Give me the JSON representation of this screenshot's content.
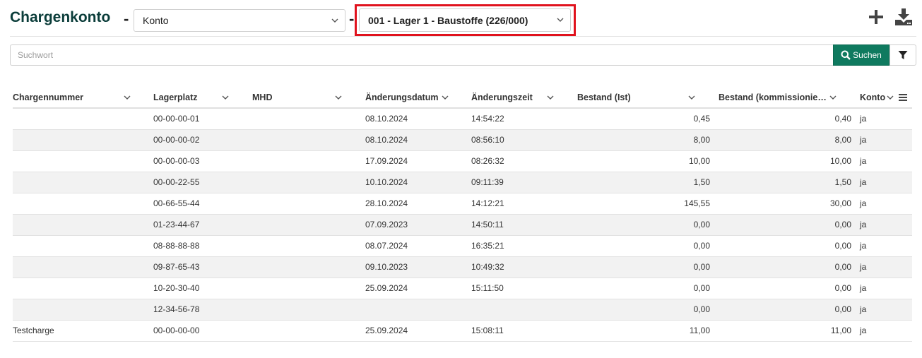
{
  "header": {
    "title": "Chargenkonto",
    "separator": "-",
    "konto_select": "Konto",
    "lager_select": "001 - Lager 1 - Baustoffe (226/000)"
  },
  "search": {
    "placeholder": "Suchwort",
    "button_label": "Suchen"
  },
  "icons": [
    "plus-icon",
    "download-icon",
    "search-icon",
    "filter-icon",
    "chevron-down-icon",
    "menu-icon"
  ],
  "colors": {
    "title": "#0b3d3a",
    "accent": "#0f7a5f",
    "highlight": "#e0121d"
  },
  "table": {
    "columns": [
      "Chargennummer",
      "Lagerplatz",
      "MHD",
      "Änderungsdatum",
      "Änderungszeit",
      "Bestand (Ist)",
      "Bestand (kommissionie…",
      "Konto"
    ],
    "rows": [
      [
        "",
        "00-00-00-01",
        "",
        "08.10.2024",
        "14:54:22",
        "0,45",
        "0,40",
        "ja"
      ],
      [
        "",
        "00-00-00-02",
        "",
        "08.10.2024",
        "08:56:10",
        "8,00",
        "8,00",
        "ja"
      ],
      [
        "",
        "00-00-00-03",
        "",
        "17.09.2024",
        "08:26:32",
        "10,00",
        "10,00",
        "ja"
      ],
      [
        "",
        "00-00-22-55",
        "",
        "10.10.2024",
        "09:11:39",
        "1,50",
        "1,50",
        "ja"
      ],
      [
        "",
        "00-66-55-44",
        "",
        "28.10.2024",
        "14:12:21",
        "145,55",
        "30,00",
        "ja"
      ],
      [
        "",
        "01-23-44-67",
        "",
        "07.09.2023",
        "14:50:11",
        "0,00",
        "0,00",
        "ja"
      ],
      [
        "",
        "08-88-88-88",
        "",
        "08.07.2024",
        "16:35:21",
        "0,00",
        "0,00",
        "ja"
      ],
      [
        "",
        "09-87-65-43",
        "",
        "09.10.2023",
        "10:49:32",
        "0,00",
        "0,00",
        "ja"
      ],
      [
        "",
        "10-20-30-40",
        "",
        "25.09.2024",
        "15:11:50",
        "0,00",
        "0,00",
        "ja"
      ],
      [
        "",
        "12-34-56-78",
        "",
        "",
        "",
        "0,00",
        "0,00",
        "ja"
      ],
      [
        "Testcharge",
        "00-00-00-00",
        "",
        "25.09.2024",
        "15:08:11",
        "11,00",
        "11,00",
        "ja"
      ]
    ]
  }
}
